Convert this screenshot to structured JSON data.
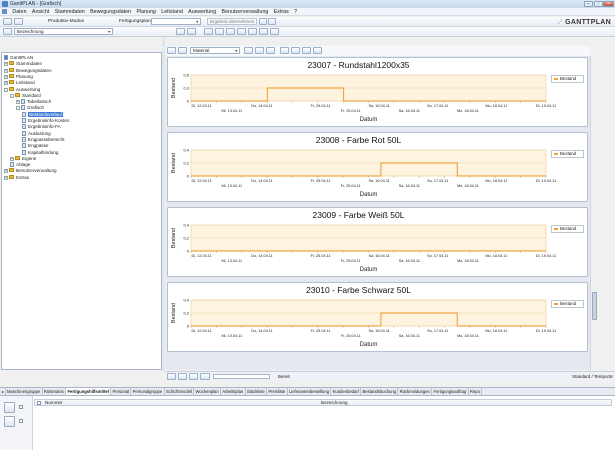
{
  "window": {
    "title": "GanttPLAN - [Grafisch]"
  },
  "menu": [
    "Daten",
    "Ansicht",
    "Stammdaten",
    "Bewegungsdaten",
    "Planung",
    "Leitstand",
    "Auswertung",
    "Benutzerverwaltung",
    "Extras",
    "?"
  ],
  "toolbar": {
    "mode_label": "Produktiv-Modus",
    "plan_label": "Fertigungsplan",
    "plan_select": "",
    "ergebnis_placeholder": "Ergebnis übernehmen",
    "search_select": "Bezeichnung"
  },
  "logo": "GANTTPLAN",
  "right_toolbar": {
    "material_select": "Material"
  },
  "tree": [
    {
      "label": "GanttPLAN",
      "depth": 0,
      "type": "root",
      "expander": ""
    },
    {
      "label": "Stammdaten",
      "depth": 0,
      "type": "folder",
      "expander": "+"
    },
    {
      "label": "Bewegungsdaten",
      "depth": 0,
      "type": "folder",
      "expander": "+"
    },
    {
      "label": "Planung",
      "depth": 0,
      "type": "folder",
      "expander": "+"
    },
    {
      "label": "Leitstand",
      "depth": 0,
      "type": "folder",
      "expander": "+"
    },
    {
      "label": "Auswertung",
      "depth": 0,
      "type": "folder",
      "expander": "-"
    },
    {
      "label": "Standard",
      "depth": 1,
      "type": "folder",
      "expander": "-"
    },
    {
      "label": "Tabellarisch",
      "depth": 2,
      "type": "doc",
      "expander": "+"
    },
    {
      "label": "Grafisch",
      "depth": 2,
      "type": "doc",
      "expander": "-"
    },
    {
      "label": "Bestandsverlauf",
      "depth": 3,
      "type": "doc",
      "expander": "",
      "selected": true
    },
    {
      "label": "Ergebnisinfo-Kosten",
      "depth": 3,
      "type": "doc",
      "expander": ""
    },
    {
      "label": "Ergebnisinfo-FA",
      "depth": 3,
      "type": "doc",
      "expander": ""
    },
    {
      "label": "Auslastung",
      "depth": 3,
      "type": "doc",
      "expander": ""
    },
    {
      "label": "Engpassübersicht",
      "depth": 3,
      "type": "doc",
      "expander": ""
    },
    {
      "label": "Engpässe",
      "depth": 3,
      "type": "doc",
      "expander": ""
    },
    {
      "label": "Kapitalbindung",
      "depth": 3,
      "type": "doc",
      "expander": ""
    },
    {
      "label": "Eigene",
      "depth": 1,
      "type": "folder",
      "expander": "+"
    },
    {
      "label": "Ablage",
      "depth": 1,
      "type": "doc",
      "expander": ""
    },
    {
      "label": "Benutzerverwaltung",
      "depth": 0,
      "type": "folder",
      "expander": "+"
    },
    {
      "label": "Extras",
      "depth": 0,
      "type": "folder",
      "expander": "+"
    }
  ],
  "chart_data": [
    {
      "type": "line",
      "title": "23007 - Rundstahl1200x35",
      "ylabel": "Bestand",
      "xlabel": "Datum",
      "legend": "Bestand",
      "y_ticks": [
        "0,6",
        "0,3",
        "0"
      ],
      "ylim": [
        0,
        0.6
      ],
      "x_ticks_top": [
        "Di, 12.04.11",
        "Do, 14.04.11",
        "Fr, 25.04.11",
        "Sa, 16.04.11",
        "So, 17.04.11",
        "Mo, 18.04.11",
        "Di, 19.04.11"
      ],
      "x_ticks_bottom": [
        "Mi, 13.04.11",
        "Fr, 25.04.11",
        "Sa, 16.04.11",
        "Mo, 18.04.11"
      ],
      "x": [
        0,
        0.215,
        0.215,
        0.43,
        0.43,
        1
      ],
      "y": [
        0,
        0,
        0.3,
        0.3,
        0,
        0
      ]
    },
    {
      "type": "line",
      "title": "23008 - Farbe Rot 50L",
      "ylabel": "Bestand",
      "xlabel": "Datum",
      "legend": "Bestand",
      "y_ticks": [
        "0,4",
        "0,2",
        "0"
      ],
      "ylim": [
        0,
        0.4
      ],
      "x_ticks_top": [
        "Di, 12.04.11",
        "Do, 14.04.11",
        "Fr, 25.04.11",
        "Sa, 16.04.11",
        "So, 17.04.11",
        "Mo, 18.04.11",
        "Di, 19.04.11"
      ],
      "x_ticks_bottom": [
        "Mi, 13.04.11",
        "Fr, 25.04.11",
        "Sa, 16.04.11",
        "Mo, 18.04.11"
      ],
      "x": [
        0,
        0.535,
        0.535,
        0.75,
        0.75,
        1
      ],
      "y": [
        0,
        0,
        0.2,
        0.2,
        0,
        0
      ]
    },
    {
      "type": "line",
      "title": "23009 - Farbe Weiß 50L",
      "ylabel": "Bestand",
      "xlabel": "Datum",
      "legend": "Bestand",
      "y_ticks": [
        "0,4",
        "0,2",
        "0"
      ],
      "ylim": [
        0,
        0.4
      ],
      "x_ticks_top": [
        "Di, 12.04.11",
        "Do, 14.04.11",
        "Fr, 25.04.11",
        "Sa, 16.04.11",
        "So, 17.04.11",
        "Mo, 18.04.11",
        "Di, 19.04.11"
      ],
      "x_ticks_bottom": [
        "Mi, 13.04.11",
        "Fr, 25.04.11",
        "Sa, 16.04.11",
        "Mo, 18.04.11"
      ],
      "x": [
        0,
        1
      ],
      "y": [
        0,
        0
      ]
    },
    {
      "type": "line",
      "title": "23010 - Farbe Schwarz 50L",
      "ylabel": "Bestand",
      "xlabel": "Datum",
      "legend": "Bestand",
      "y_ticks": [
        "0,4",
        "0,2",
        "0"
      ],
      "ylim": [
        0,
        0.4
      ],
      "x_ticks_top": [
        "Di, 12.04.11",
        "Do, 14.04.11",
        "Fr, 25.04.11",
        "Sa, 16.04.11",
        "So, 17.04.11",
        "Mo, 18.04.11",
        "Di, 19.04.11"
      ],
      "x_ticks_bottom": [
        "Mi, 13.04.11",
        "Fr, 25.04.11",
        "Sa, 16.04.11",
        "Mo, 18.04.11"
      ],
      "x": [
        0,
        0.535,
        0.535,
        0.75,
        0.75,
        1
      ],
      "y": [
        0,
        0,
        0.2,
        0.2,
        0,
        0
      ]
    }
  ],
  "colors": {
    "series": "#e8951f",
    "fill": "#fdf3de",
    "grid": "#f2d9a8"
  },
  "status": {
    "ready": "Bereit",
    "right": "Standard / Temporär"
  },
  "tabs": [
    "Maschinengruppe",
    "Rüstmatrix",
    "Fertigungshilfsmittel",
    "Personal",
    "Personalgruppe",
    "Schichtmodell",
    "Wochenplan",
    "Arbeitsplan",
    "Stückliste",
    "Preisliste",
    "Lieferantenbestellung",
    "Kundenbedarf",
    "Bestandsbuchung",
    "Rückmeldungen",
    "Fertigungsauftrag",
    "Repo"
  ],
  "active_tab": "Fertigungshilfsmittel",
  "grid": {
    "col1": "Nummer",
    "col2": "Bezeichnung"
  }
}
